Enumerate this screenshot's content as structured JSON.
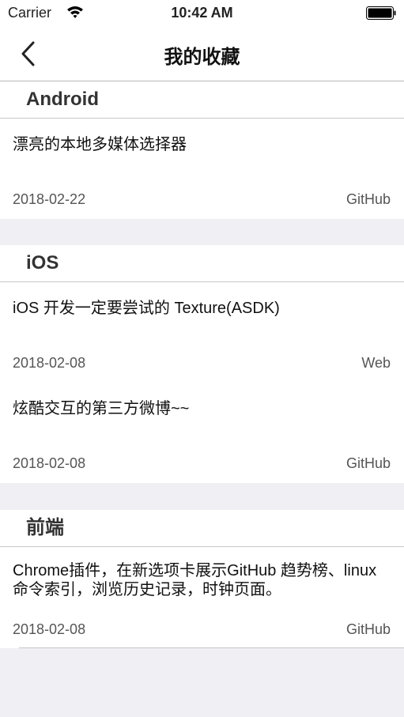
{
  "status_bar": {
    "carrier": "Carrier",
    "time": "10:42 AM"
  },
  "nav": {
    "title": "我的收藏"
  },
  "sections": [
    {
      "title": "Android",
      "items": [
        {
          "title": "漂亮的本地多媒体选择器",
          "date": "2018-02-22",
          "source": "GitHub"
        }
      ]
    },
    {
      "title": "iOS",
      "items": [
        {
          "title": "iOS 开发一定要尝试的 Texture(ASDK)",
          "date": "2018-02-08",
          "source": "Web"
        },
        {
          "title": "炫酷交互的第三方微博~~",
          "date": "2018-02-08",
          "source": "GitHub"
        }
      ]
    },
    {
      "title": "前端",
      "items": [
        {
          "title": "Chrome插件，在新选项卡展示GitHub 趋势榜、linux 命令索引，浏览历史记录，时钟页面。",
          "date": "2018-02-08",
          "source": "GitHub"
        }
      ]
    }
  ]
}
